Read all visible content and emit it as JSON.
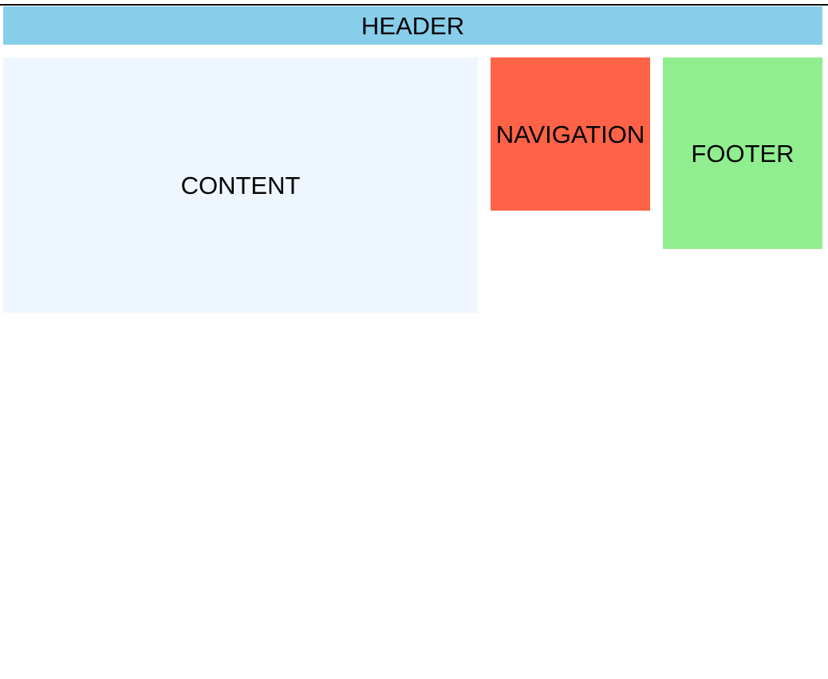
{
  "layout": {
    "header": {
      "label": "HEADER",
      "color": "#87CEEB"
    },
    "content": {
      "label": "CONTENT",
      "color": "#EEF7FF"
    },
    "navigation": {
      "label": "NAVIGATION",
      "color": "#FF6347"
    },
    "footer": {
      "label": "FOOTER",
      "color": "#90EE90"
    }
  }
}
